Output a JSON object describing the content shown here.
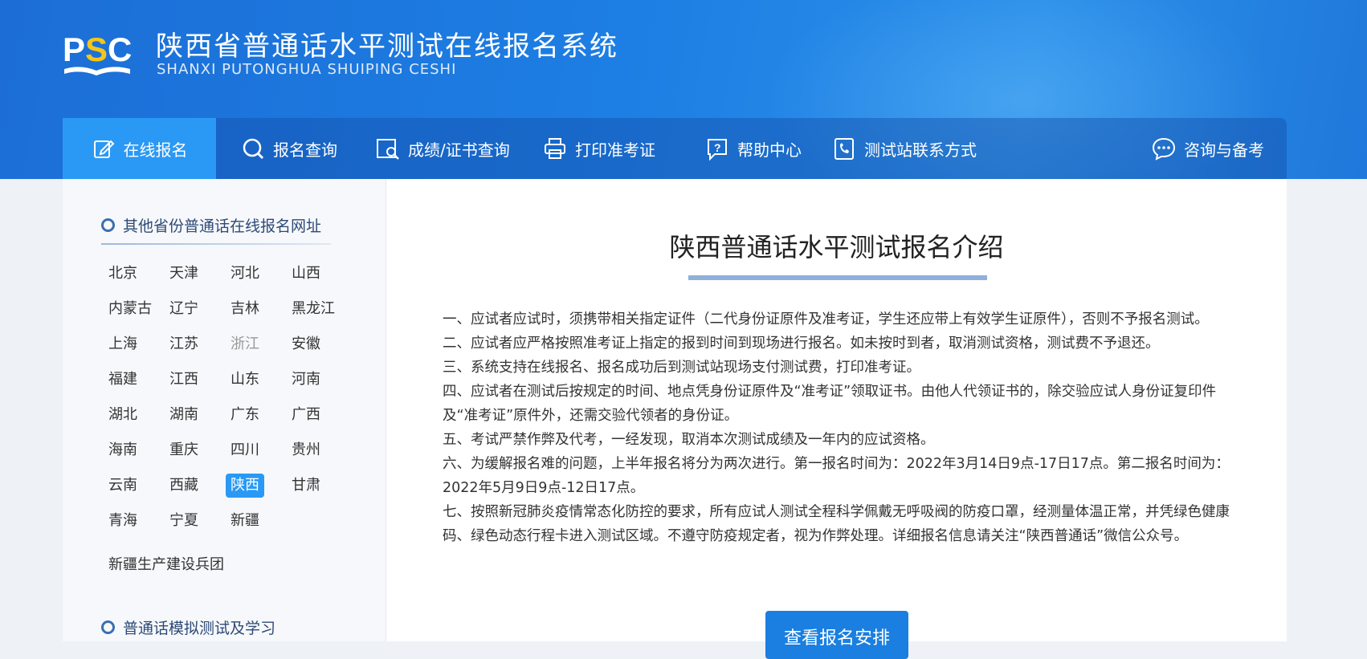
{
  "header": {
    "logo_text": "PSC",
    "title": "陕西省普通话水平测试在线报名系统",
    "subtitle": "SHANXI PUTONGHUA SHUIPING CESHI"
  },
  "nav": {
    "items": [
      {
        "label": "在线报名",
        "icon": "edit-icon",
        "active": true
      },
      {
        "label": "报名查询",
        "icon": "search-icon"
      },
      {
        "label": "成绩/证书查询",
        "icon": "document-search-icon"
      },
      {
        "label": "打印准考证",
        "icon": "printer-icon"
      },
      {
        "label": "帮助中心",
        "icon": "help-icon"
      },
      {
        "label": "测试站联系方式",
        "icon": "phone-book-icon"
      },
      {
        "label": "咨询与备考",
        "icon": "chat-icon"
      }
    ],
    "active_color": "#2a99f5"
  },
  "sidebar": {
    "section1_title": "其他省份普通话在线报名网址",
    "provinces": [
      "北京",
      "天津",
      "河北",
      "山西",
      "内蒙古",
      "辽宁",
      "吉林",
      "黑龙江",
      "上海",
      "江苏",
      "浙江",
      "安徽",
      "福建",
      "江西",
      "山东",
      "河南",
      "湖北",
      "湖南",
      "广东",
      "广西",
      "海南",
      "重庆",
      "四川",
      "贵州",
      "云南",
      "西藏",
      "陕西",
      "甘肃",
      "青海",
      "宁夏",
      "新疆"
    ],
    "disabled_province": "浙江",
    "active_province": "陕西",
    "extra_item": "新疆生产建设兵团",
    "section2_title": "普通话模拟测试及学习"
  },
  "main": {
    "title": "陕西普通话水平测试报名介绍",
    "rules": [
      "一、应试者应试时，须携带相关指定证件（二代身份证原件及准考证，学生还应带上有效学生证原件），否则不予报名测试。",
      "二、应试者应严格按照准考证上指定的报到时间到现场进行报名。如未按时到者，取消测试资格，测试费不予退还。",
      "三、系统支持在线报名、报名成功后到测试站现场支付测试费，打印准考证。",
      "四、应试者在测试后按规定的时间、地点凭身份证原件及“准考证”领取证书。由他人代领证书的，除交验应试人身份证复印件及“准考证”原件外，还需交验代领者的身份证。",
      "五、考试严禁作弊及代考，一经发现，取消本次测试成绩及一年内的应试资格。",
      "六、为缓解报名难的问题，上半年报名将分为两次进行。第一报名时间为：2022年3月14日9点-17日17点。第二报名时间为：2022年5月9日9点-12日17点。",
      "七、按照新冠肺炎疫情常态化防控的要求，所有应试人测试全程科学佩戴无呼吸阀的防疫口罩，经测量体温正常，并凭绿色健康码、绿色动态行程卡进入测试区域。不遵守防疫规定者，视为作弊处理。详细报名信息请关注“陕西普通话”微信公众号。"
    ],
    "cta_label": "查看报名安排"
  }
}
